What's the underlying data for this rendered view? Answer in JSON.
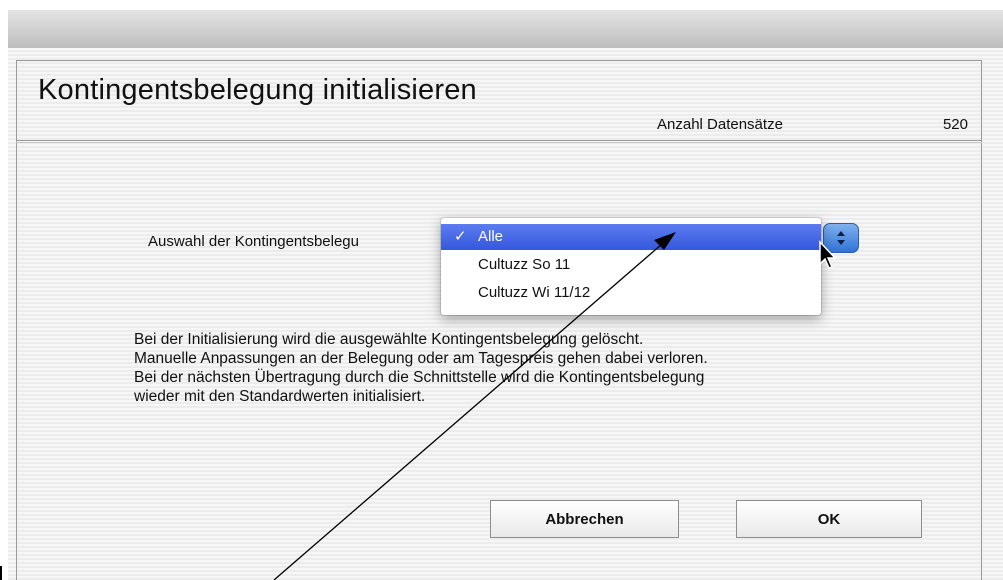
{
  "header": {
    "title": "Kontingentsbelegung initialisieren",
    "record_count_label": "Anzahl Datensätze",
    "record_count_value": "520"
  },
  "selection": {
    "label": "Auswahl der Kontingentsbelegu",
    "options": [
      {
        "label": "Alle",
        "checked": true
      },
      {
        "label": "Cultuzz So 11",
        "checked": false
      },
      {
        "label": "Cultuzz Wi 11/12",
        "checked": false
      }
    ],
    "check_mark": "✓"
  },
  "info_lines": [
    "Bei der Initialisierung wird die ausgewählte Kontingentsbelegung gelöscht.",
    "Manuelle Anpassungen an der Belegung oder am Tagespreis gehen dabei verloren.",
    "Bei der nächsten Übertragung durch die Schnittstelle wird die Kontingentsbelegung",
    "wieder mit den Standardwerten initialisiert."
  ],
  "buttons": {
    "cancel": "Abbrechen",
    "ok": "OK"
  },
  "colors": {
    "menu_highlight": "#3f63e4",
    "stepper": "#4a8ae4",
    "background": "#ededed"
  },
  "icons": {
    "stepper": "up-down-chevron-icon",
    "cursor": "mouse-pointer-icon",
    "annotation": "arrow-icon"
  }
}
